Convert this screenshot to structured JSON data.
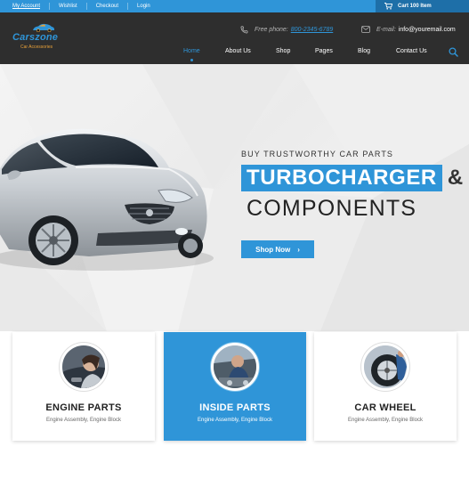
{
  "topbar": {
    "links": [
      "My Account",
      "Wishlist",
      "Checkout",
      "Login"
    ],
    "cart_label": "Cart 100 Item"
  },
  "header": {
    "logo_title": "Carszone",
    "logo_subtitle": "Car Accessories",
    "phone_label": "Free phone:",
    "phone_value": "800-2345-6789",
    "email_label": "E-mail:",
    "email_value": "info@youremail.com"
  },
  "nav": {
    "items": [
      "Home",
      "About Us",
      "Shop",
      "Pages",
      "Blog",
      "Contact Us"
    ],
    "active": "Home"
  },
  "hero": {
    "eyebrow": "BUY TRUSTWORTHY CAR PARTS",
    "headline_highlight": "TURBOCHARGER",
    "headline_amp": "&",
    "headline_line2": "COMPONENTS",
    "cta_label": "Shop Now",
    "cta_icon": "chevron-right-icon"
  },
  "categories": [
    {
      "title": "ENGINE PARTS",
      "desc": "Engine Assembly, Engine Block",
      "active": false
    },
    {
      "title": "INSIDE PARTS",
      "desc": "Engine Assembly, Engine Block",
      "active": true
    },
    {
      "title": "CAR WHEEL",
      "desc": "Engine Assembly, Engine Block",
      "active": false
    }
  ],
  "colors": {
    "accent": "#2f95d8",
    "header_bg": "#2e2e2e",
    "logo_orange": "#e8a23a"
  }
}
